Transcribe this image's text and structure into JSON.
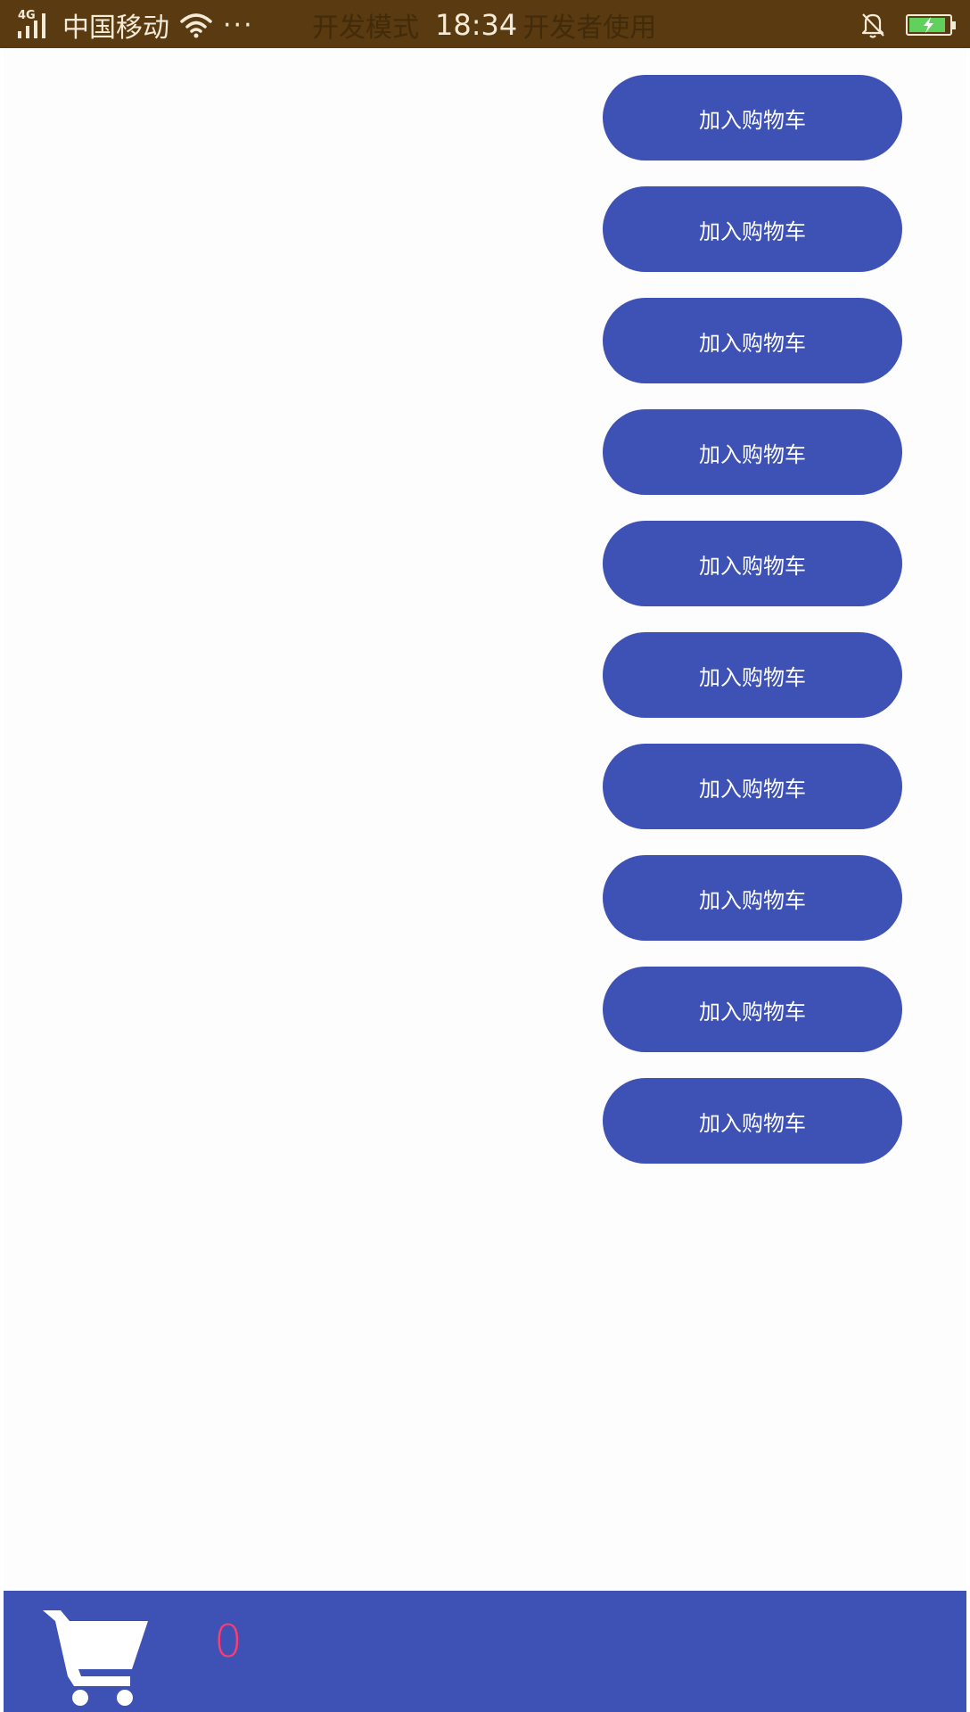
{
  "status_bar": {
    "network_type": "4G",
    "carrier": "中国移动",
    "more_dots": "···",
    "ghost_left": "开发模式",
    "time": "18:34",
    "ghost_right": "开发者使用",
    "battery_level": 0.9,
    "colors": {
      "background": "#5a3a10",
      "text": "#f3ead8",
      "battery": "#5fd15c"
    }
  },
  "products": {
    "buttons": [
      {
        "label": "加入购物车"
      },
      {
        "label": "加入购物车"
      },
      {
        "label": "加入购物车"
      },
      {
        "label": "加入购物车"
      },
      {
        "label": "加入购物车"
      },
      {
        "label": "加入购物车"
      },
      {
        "label": "加入购物车"
      },
      {
        "label": "加入购物车"
      },
      {
        "label": "加入购物车"
      },
      {
        "label": "加入购物车"
      }
    ],
    "button_color": "#3e51b5"
  },
  "cart_bar": {
    "icon": "shopping-cart-icon",
    "count": "0",
    "count_color": "#ff3c6e",
    "background": "#3e51b5"
  }
}
